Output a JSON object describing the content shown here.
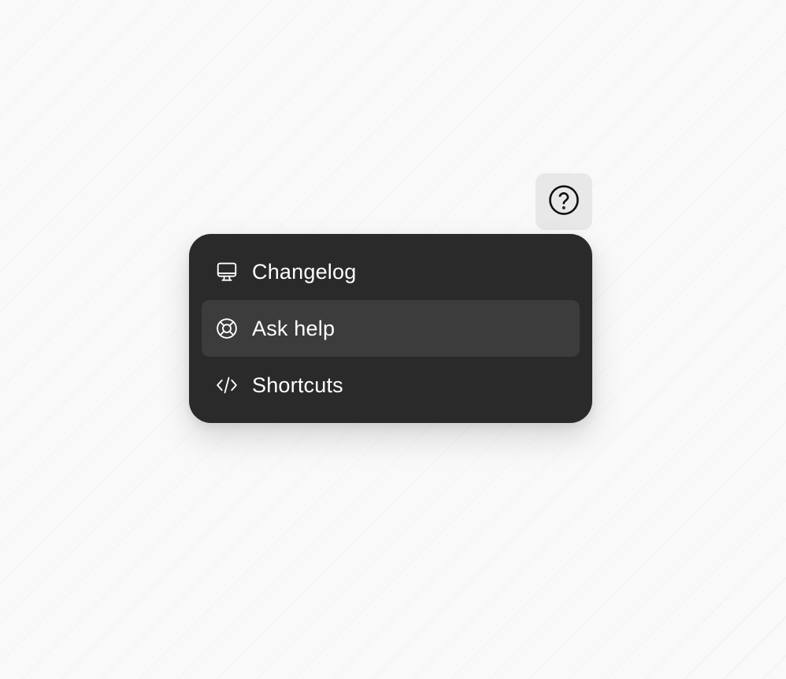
{
  "help_button": {
    "icon": "question-circle-icon"
  },
  "menu": {
    "items": [
      {
        "label": "Changelog",
        "icon": "monitor-icon",
        "active": false
      },
      {
        "label": "Ask help",
        "icon": "lifebuoy-icon",
        "active": true
      },
      {
        "label": "Shortcuts",
        "icon": "code-icon",
        "active": false
      }
    ]
  },
  "colors": {
    "menu_background": "#2a2a2a",
    "menu_item_active": "#3c3c3c",
    "menu_text": "#ffffff",
    "trigger_background": "#e8e8e8",
    "page_background": "#f9f9f9"
  }
}
